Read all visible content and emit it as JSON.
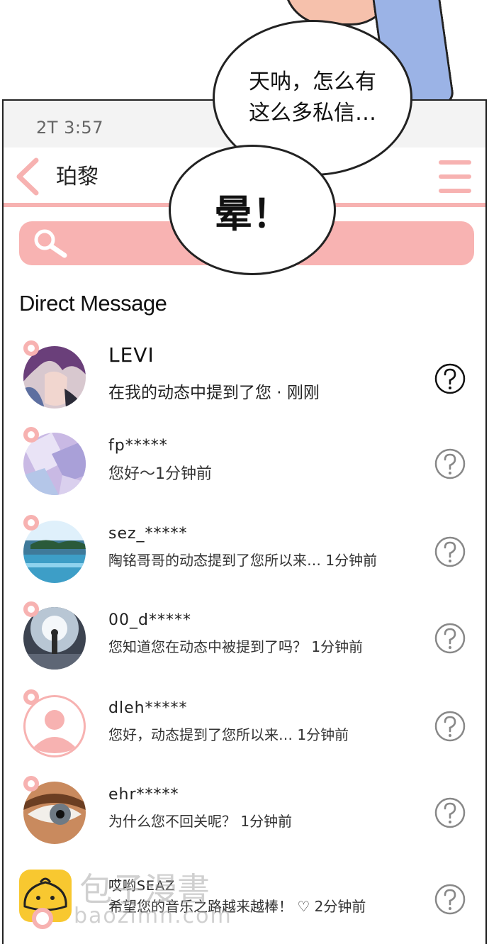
{
  "comic": {
    "bubble_top": "天呐，怎么有\n这么多私信…",
    "bubble_center": "晕！"
  },
  "status_bar": {
    "carrier": "2T",
    "time": "3:57"
  },
  "nav": {
    "title": "珀黎"
  },
  "section_title": "Direct Message",
  "messages": [
    {
      "name": "LEVI",
      "text": "在我的动态中提到了您 · 刚刚",
      "avatar": "purple-haired-man"
    },
    {
      "name": "fp*****",
      "text": "您好～1分钟前",
      "avatar": "crystal-lights"
    },
    {
      "name": "sez_*****",
      "text": "陶铭哥哥的动态提到了您所以来… 1分钟前",
      "avatar": "island-sea"
    },
    {
      "name": "00_d*****",
      "text": "您知道您在动态中被提到了吗？   1分钟前",
      "avatar": "person-in-light"
    },
    {
      "name": "dleh*****",
      "text": "您好，动态提到了您所以来… 1分钟前",
      "avatar": "default-user"
    },
    {
      "name": "ehr*****",
      "text": "为什么您不回关呢？   1分钟前",
      "avatar": "eye-closeup"
    },
    {
      "name": "哎哟SEAZ",
      "text": "希望您的音乐之路越来越棒！ ♡ 2分钟前",
      "avatar": "watermark-bun-logo"
    }
  ],
  "watermark": {
    "cn": "包子漫書",
    "url": "baozimh.com"
  },
  "colors": {
    "accent_pink": "#f7b2b1",
    "status_bg": "#f3f3f3"
  }
}
